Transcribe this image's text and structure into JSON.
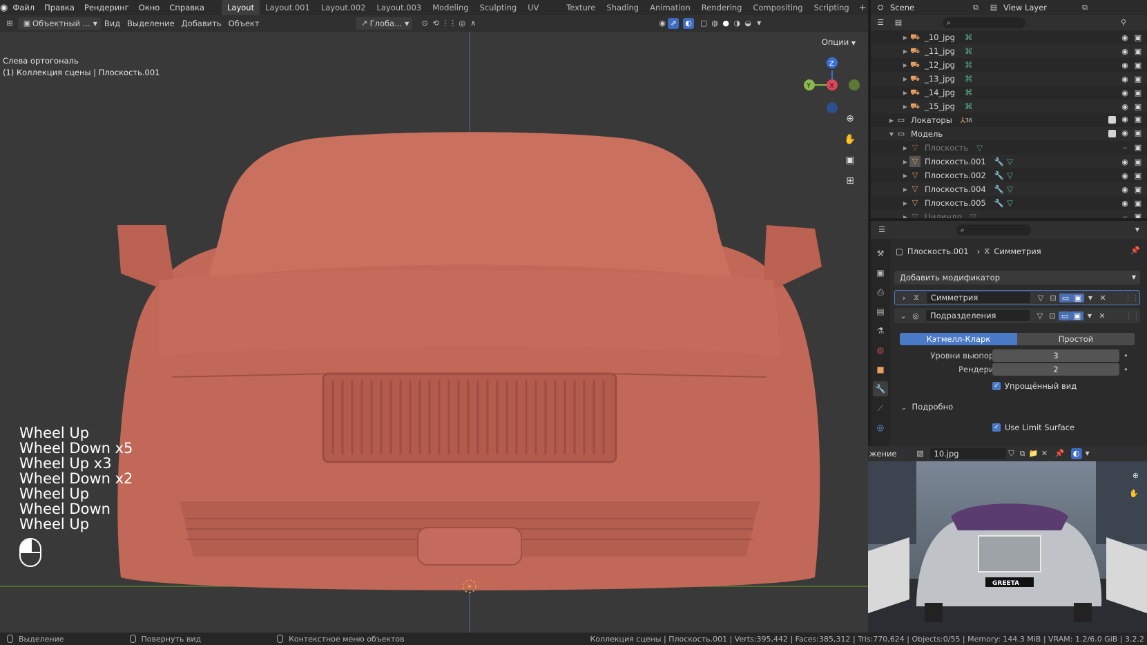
{
  "topbar": {
    "menus": [
      "Файл",
      "Правка",
      "Рендеринг",
      "Окно",
      "Справка"
    ],
    "workspaces": [
      "Layout",
      "Layout.001",
      "Layout.002",
      "Layout.003",
      "Modeling",
      "Sculpting",
      "UV Editing",
      "Texture Paint",
      "Shading",
      "Animation",
      "Rendering",
      "Compositing",
      "Scripting"
    ],
    "active_workspace": "Layout",
    "scene": "Scene",
    "view_layer": "View Layer"
  },
  "viewport_header": {
    "mode": "Объектный ...",
    "menus": [
      "Вид",
      "Выделение",
      "Добавить",
      "Объект"
    ],
    "orientation": "Глоба...",
    "options": "Опции"
  },
  "viewport": {
    "view_name": "Слева ортогональ",
    "collection_info": "(1) Коллекция сцены | Плоскость.001",
    "key_log": [
      "Wheel Up",
      "Wheel Down x5",
      "Wheel Up x3",
      "Wheel Down x2",
      "Wheel Up",
      "Wheel Down",
      "Wheel Up"
    ],
    "gizmo": {
      "z": "Z",
      "y": "Y",
      "x": "X"
    },
    "model_color": "#c46a5e",
    "background_color": "#393939"
  },
  "outliner": {
    "rows": [
      {
        "name": "_10_jpg",
        "icon": "camera-icon",
        "dim": false
      },
      {
        "name": "_11_jpg",
        "icon": "camera-icon",
        "dim": false
      },
      {
        "name": "_12_jpg",
        "icon": "camera-icon",
        "dim": false
      },
      {
        "name": "_13_jpg",
        "icon": "camera-icon",
        "dim": false
      },
      {
        "name": "_14_jpg",
        "icon": "camera-icon",
        "dim": false
      },
      {
        "name": "_15_jpg",
        "icon": "camera-icon",
        "dim": false
      },
      {
        "name": "Локаторы",
        "icon": "collection-icon",
        "dim": false,
        "badge": "36"
      },
      {
        "name": "Модель",
        "icon": "collection-icon",
        "dim": false
      },
      {
        "name": "Плоскость",
        "icon": "mesh-icon",
        "dim": true
      },
      {
        "name": "Плоскость.001",
        "icon": "mesh-icon",
        "dim": false
      },
      {
        "name": "Плоскость.002",
        "icon": "mesh-icon",
        "dim": false
      },
      {
        "name": "Плоскость.004",
        "icon": "mesh-icon",
        "dim": false
      },
      {
        "name": "Плоскость.005",
        "icon": "mesh-icon",
        "dim": false
      },
      {
        "name": "Цилиндр",
        "icon": "mesh-icon",
        "dim": true
      }
    ]
  },
  "properties": {
    "object_name": "Плоскость.001",
    "modifier_crumb": "Симметрия",
    "add_modifier": "Добавить модификатор",
    "modifiers": [
      {
        "name": "Симметрия"
      },
      {
        "name": "Подразделения"
      }
    ],
    "subdiv_types": [
      "Кэтмелл-Кларк",
      "Простой"
    ],
    "levels_label": "Уровни вьюпорта",
    "levels_value": "3",
    "render_label": "Рендеринг",
    "render_value": "2",
    "optimal_display": "Упрощённый вид",
    "advanced": "Подробно",
    "limit_surface": "Use Limit Surface"
  },
  "image_editor": {
    "label": "жение",
    "image_name": "10.jpg",
    "plate_text": "GREETA"
  },
  "statusbar": {
    "left1": "Выделение",
    "left2": "Повернуть вид",
    "left3": "Контекстное меню объектов",
    "stats": "Коллекция сцены | Плоскость.001 | Verts:395,442 | Faces:385,312 | Tris:770,624 | Objects:0/55 | Memory: 144.3 MiB | VRAM: 1.2/6.0 GiB | 3.2.2"
  }
}
